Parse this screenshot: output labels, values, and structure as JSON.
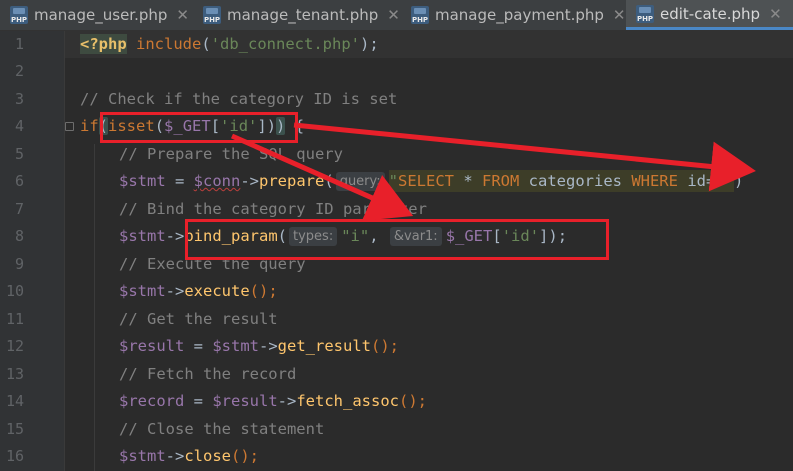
{
  "tabs": [
    {
      "label": "manage_user.php",
      "active": false,
      "icon": "php-file-icon"
    },
    {
      "label": "manage_tenant.php",
      "active": false,
      "icon": "php-file-icon"
    },
    {
      "label": "manage_payment.php",
      "active": false,
      "icon": "php-file-icon"
    },
    {
      "label": "edit-cate.php",
      "active": true,
      "icon": "php-file-icon"
    }
  ],
  "close_glyph": "✕",
  "line_numbers": [
    "1",
    "2",
    "3",
    "4",
    "5",
    "6",
    "7",
    "8",
    "9",
    "10",
    "11",
    "12",
    "13",
    "14",
    "15",
    "16"
  ],
  "code": {
    "l1": {
      "open_tag": "<?php",
      "kw": "include",
      "p1": "(",
      "str": "'db_connect.php'",
      "p2": ");"
    },
    "l3": {
      "comment": "// Check if the category ID is set"
    },
    "l4": {
      "kw_if": "if",
      "p_open": "(",
      "fn": "isset",
      "p2": "(",
      "var": "$_GET",
      "b1": "[",
      "str": "'id'",
      "b2": "])",
      "p_close": ")",
      "brace": " {"
    },
    "l5": {
      "comment": "// Prepare the SQL query"
    },
    "l6": {
      "var1": "$stmt",
      "eq": " = ",
      "var2": "$conn",
      "arrow": "->",
      "fn": "prepare",
      "p1": "(",
      "hint": "query:",
      "q_open": "\"",
      "sql_kw1": "SELECT",
      "sql_star": " * ",
      "sql_kw2": "FROM",
      "sql_tbl": " categories ",
      "sql_kw3": "WHERE",
      "sql_cond": " id=?",
      "q_close": "\"",
      "p2": ")"
    },
    "l7": {
      "comment": "// Bind the category ID parameter"
    },
    "l8": {
      "var1": "$stmt",
      "arrow": "->",
      "fn": "bind_param",
      "p1": "(",
      "hint1": "types:",
      "str1": "\"i\"",
      "comma": ", ",
      "hint2": "&var1:",
      "var2": "$_GET",
      "b1": "[",
      "str2": "'id'",
      "b2": "]",
      "p2": ");"
    },
    "l9": {
      "comment": "// Execute the query"
    },
    "l10": {
      "var1": "$stmt",
      "arrow": "->",
      "fn": "execute",
      "p": "();"
    },
    "l11": {
      "comment": "// Get the result"
    },
    "l12": {
      "var1": "$result",
      "eq": " = ",
      "var2": "$stmt",
      "arrow": "->",
      "fn": "get_result",
      "p": "();"
    },
    "l13": {
      "comment": "// Fetch the record"
    },
    "l14": {
      "var1": "$record",
      "eq": " = ",
      "var2": "$result",
      "arrow": "->",
      "fn": "fetch_assoc",
      "p": "();"
    },
    "l15": {
      "comment": "// Close the statement"
    },
    "l16": {
      "var1": "$stmt",
      "arrow": "->",
      "fn": "close",
      "p": "();"
    }
  },
  "annotation_color": "#e8202a"
}
